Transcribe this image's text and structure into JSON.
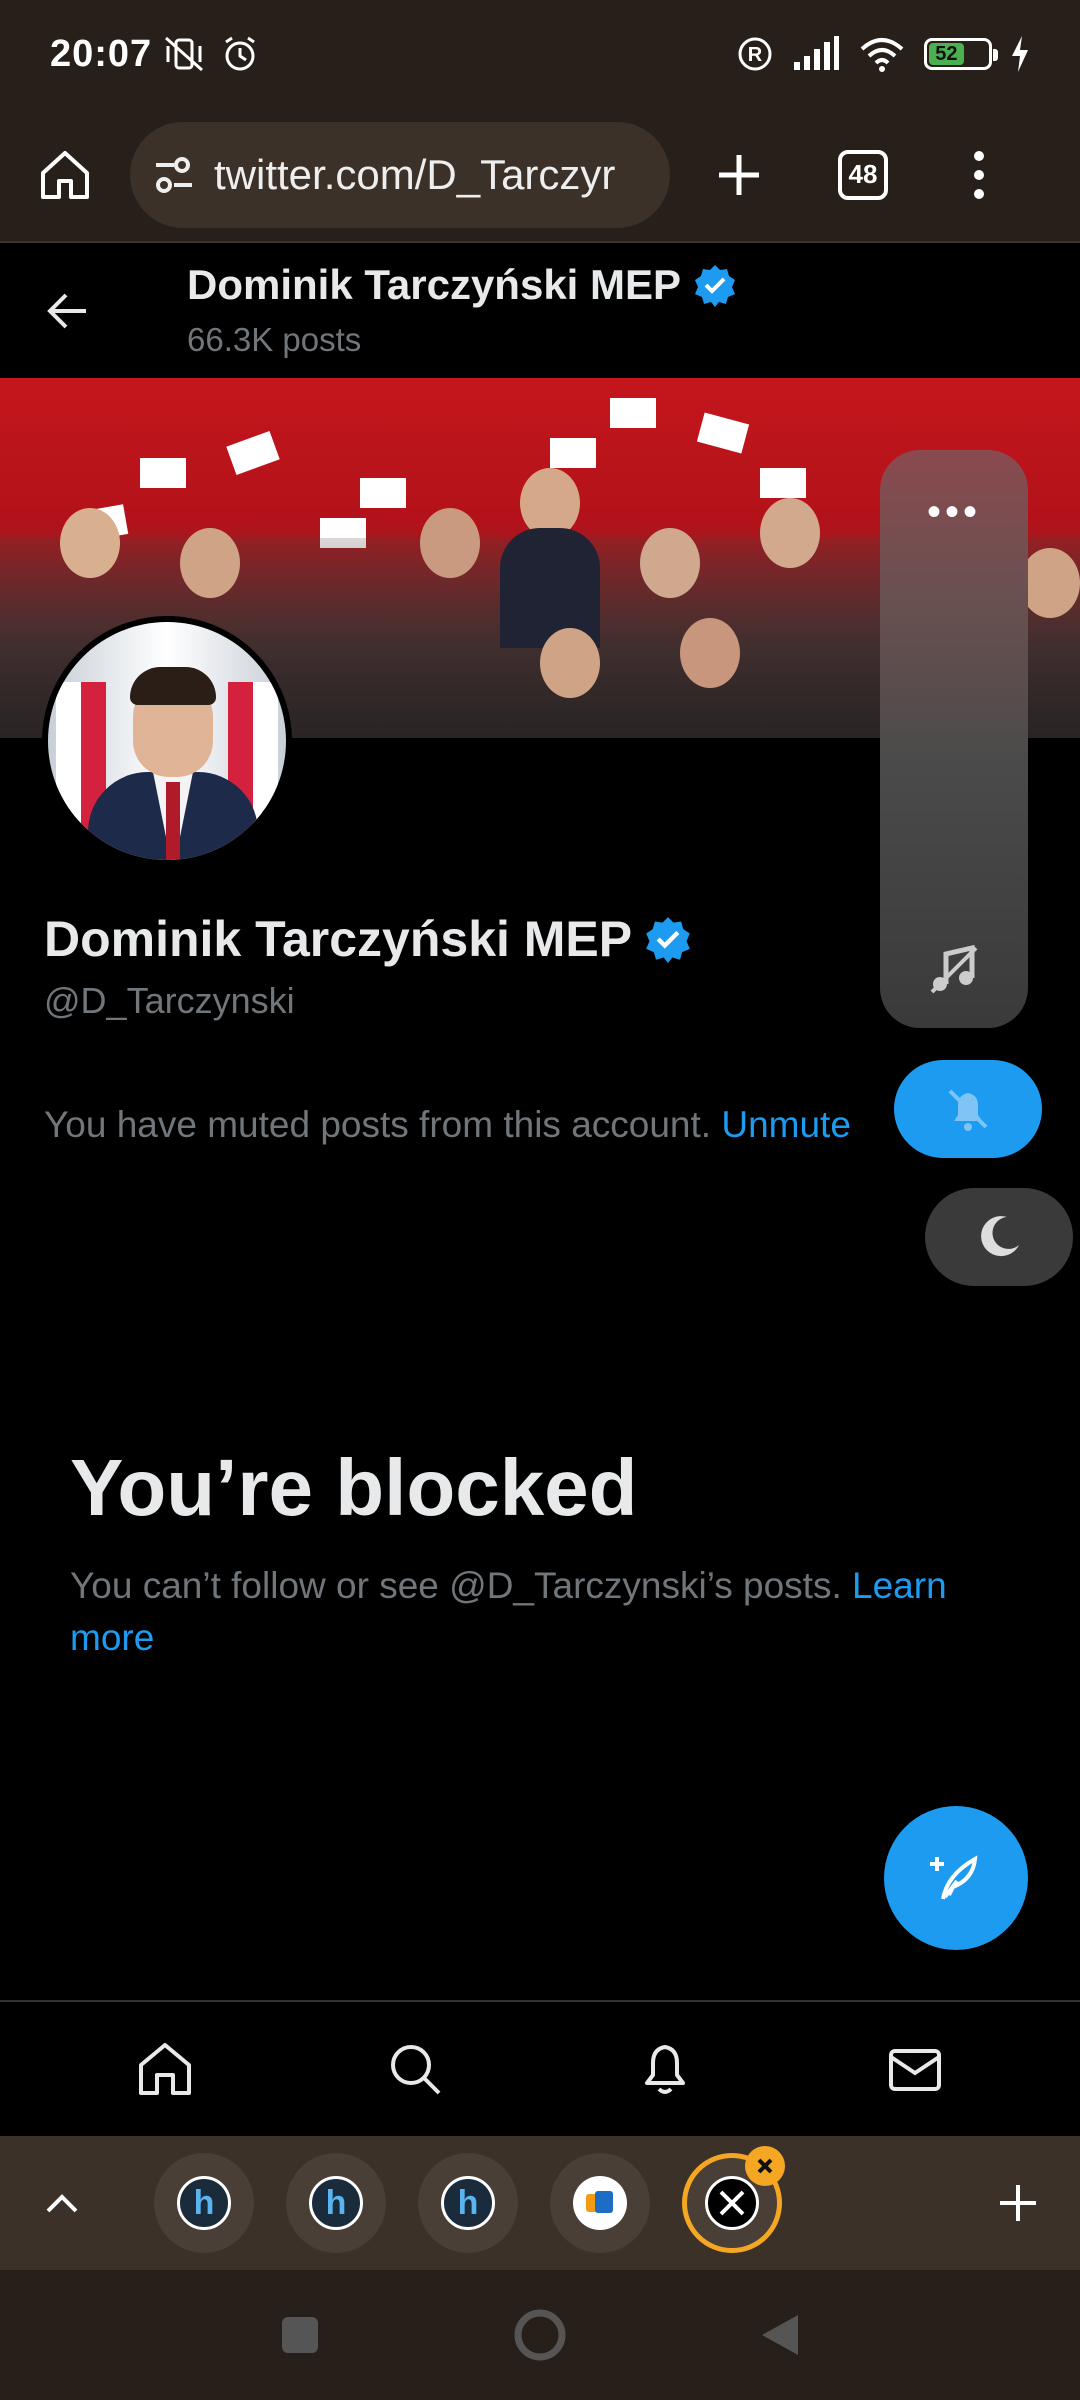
{
  "status_bar": {
    "time": "20:07",
    "battery": "52"
  },
  "browser": {
    "url": "twitter.com/D_Tarczyr",
    "tab_count": "48"
  },
  "header": {
    "name": "Dominik Tarczyński MEP",
    "posts": "66.3K posts"
  },
  "profile": {
    "name": "Dominik Tarczyński MEP",
    "handle": "@D_Tarczynski",
    "muted_text": "You have muted posts from this account. ",
    "unmute_label": "Unmute"
  },
  "blocked": {
    "title": "You’re blocked",
    "text": "You can’t follow or see @D_Tarczynski’s posts. ",
    "learn_more": "Learn more"
  },
  "side_panel": {
    "dots": "•••"
  },
  "tabs": [
    "h",
    "h",
    "h"
  ],
  "colors": {
    "accent": "#1d9bf0",
    "active_tab": "#f5a623"
  }
}
